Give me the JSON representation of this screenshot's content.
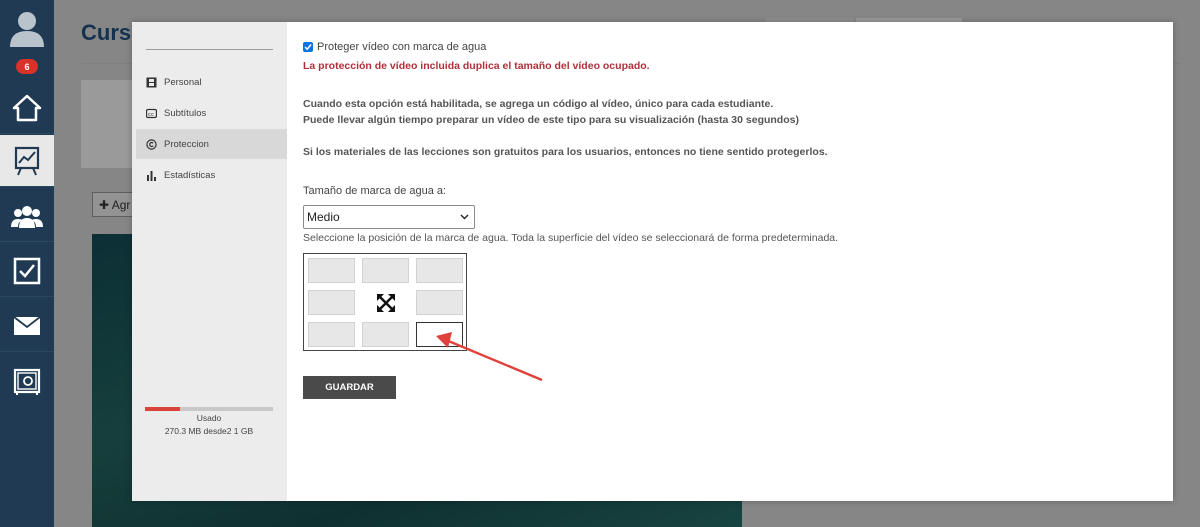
{
  "sidebar": {
    "badge_count": "6",
    "items": [
      {
        "name": "home-icon"
      },
      {
        "name": "course-board-icon"
      },
      {
        "name": "users-icon"
      },
      {
        "name": "checkbox-icon"
      },
      {
        "name": "mail-icon"
      },
      {
        "name": "safe-icon"
      }
    ]
  },
  "background": {
    "page_title": "Curs",
    "add_button_label": "Agr"
  },
  "modal": {
    "nav": [
      {
        "label": "Personal",
        "icon": "film-icon"
      },
      {
        "label": "Subtítulos",
        "icon": "subtitles-icon"
      },
      {
        "label": "Proteccion",
        "icon": "copyright-icon"
      },
      {
        "label": "Estadísticas",
        "icon": "bar-chart-icon"
      }
    ],
    "storage": {
      "used_fraction": 0.27,
      "label": "Usado",
      "value": "270.3 MB desde2 1 GB"
    },
    "protect_checkbox_label": "Proteger vídeo con marca de agua",
    "protect_checked": true,
    "warning": "La protección de vídeo incluida duplica el tamaño del vídeo ocupado.",
    "info_line1": "Cuando esta opción está habilitada, se agrega un código al vídeo, único para cada estudiante.",
    "info_line2": "Puede llevar algún tiempo preparar un vídeo de este tipo para su visualización (hasta 30 segundos)",
    "info_line3": "Si los materiales de las lecciones son gratuitos para los usuarios, entonces no tiene sentido protegerlos.",
    "size_label": "Tamaño de marca de agua a:",
    "size_value": "Medio",
    "position_hint": "Seleccione la posición de la marca de agua. Toda la superficie del vídeo se seleccionará de forma predeterminada.",
    "save_label": "GUARDAR"
  },
  "colors": {
    "sidebar": "#1f3a52",
    "warning": "#b0303a",
    "arrow": "#e0413a"
  }
}
